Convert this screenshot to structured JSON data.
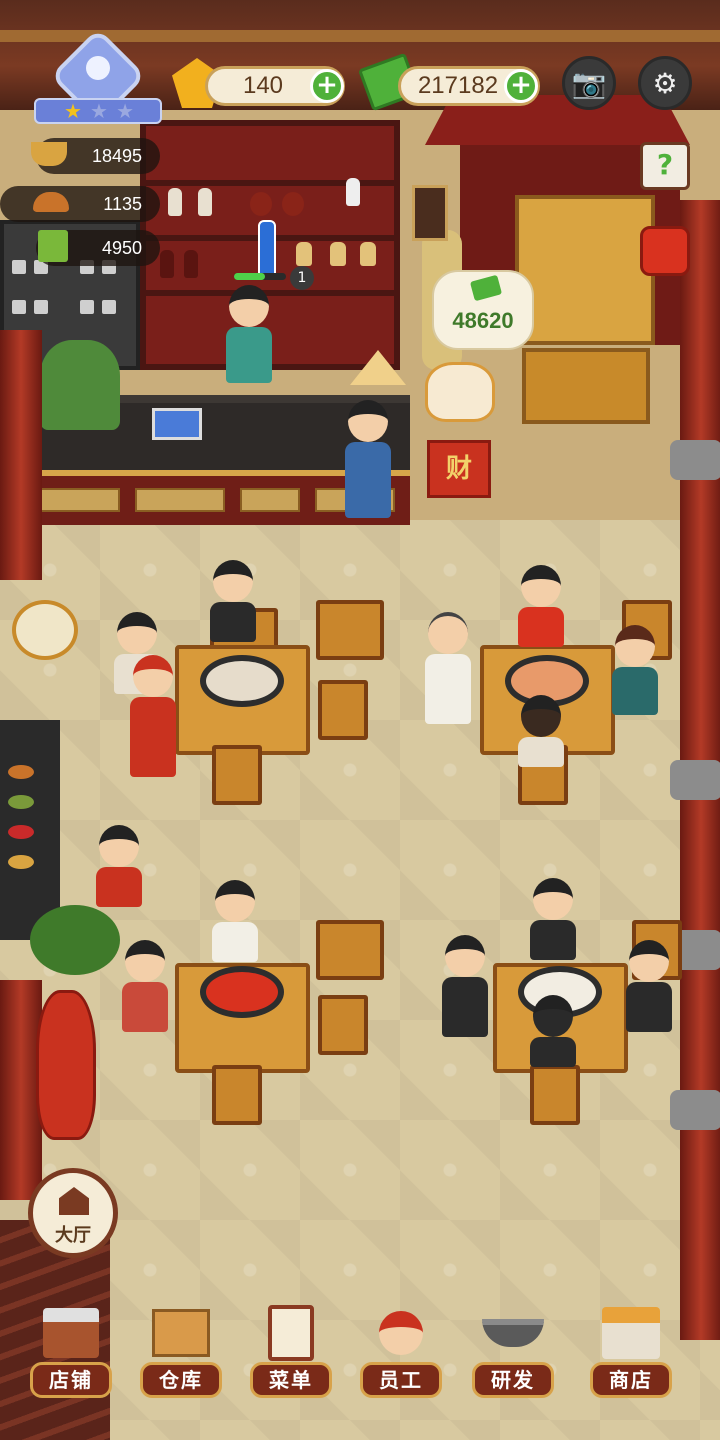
{
  "hud": {
    "gems": {
      "value": "140",
      "icon": "diamond-icon",
      "color": "#f2b01e"
    },
    "cash": {
      "value": "217182",
      "icon": "cash-icon",
      "color": "#4fb13a"
    },
    "level_stars": 1,
    "level_stars_total": 3,
    "camera_icon": "camera-icon",
    "settings_icon": "gear-icon"
  },
  "stats": [
    {
      "icon": "hotpot-icon",
      "value": "18495"
    },
    {
      "icon": "cloche-icon",
      "value": "1135"
    },
    {
      "icon": "menu-book-icon",
      "value": "4950"
    }
  ],
  "scene": {
    "lucky_cat_coins": "48620",
    "lucky_cat_sign": "财",
    "bartender_badge": "1",
    "hall_button": "大厅",
    "help_icon": "help-book-icon",
    "task_icon": "task-book-icon"
  },
  "nav": [
    {
      "key": "shop",
      "label": "店铺",
      "icon": "storefront-icon"
    },
    {
      "key": "warehouse",
      "label": "仓库",
      "icon": "boxes-icon"
    },
    {
      "key": "menu",
      "label": "菜单",
      "icon": "clipboard-icon"
    },
    {
      "key": "staff",
      "label": "员工",
      "icon": "chef-icon"
    },
    {
      "key": "research",
      "label": "研发",
      "icon": "wok-icon"
    },
    {
      "key": "store",
      "label": "商店",
      "icon": "shop-stall-icon"
    }
  ]
}
